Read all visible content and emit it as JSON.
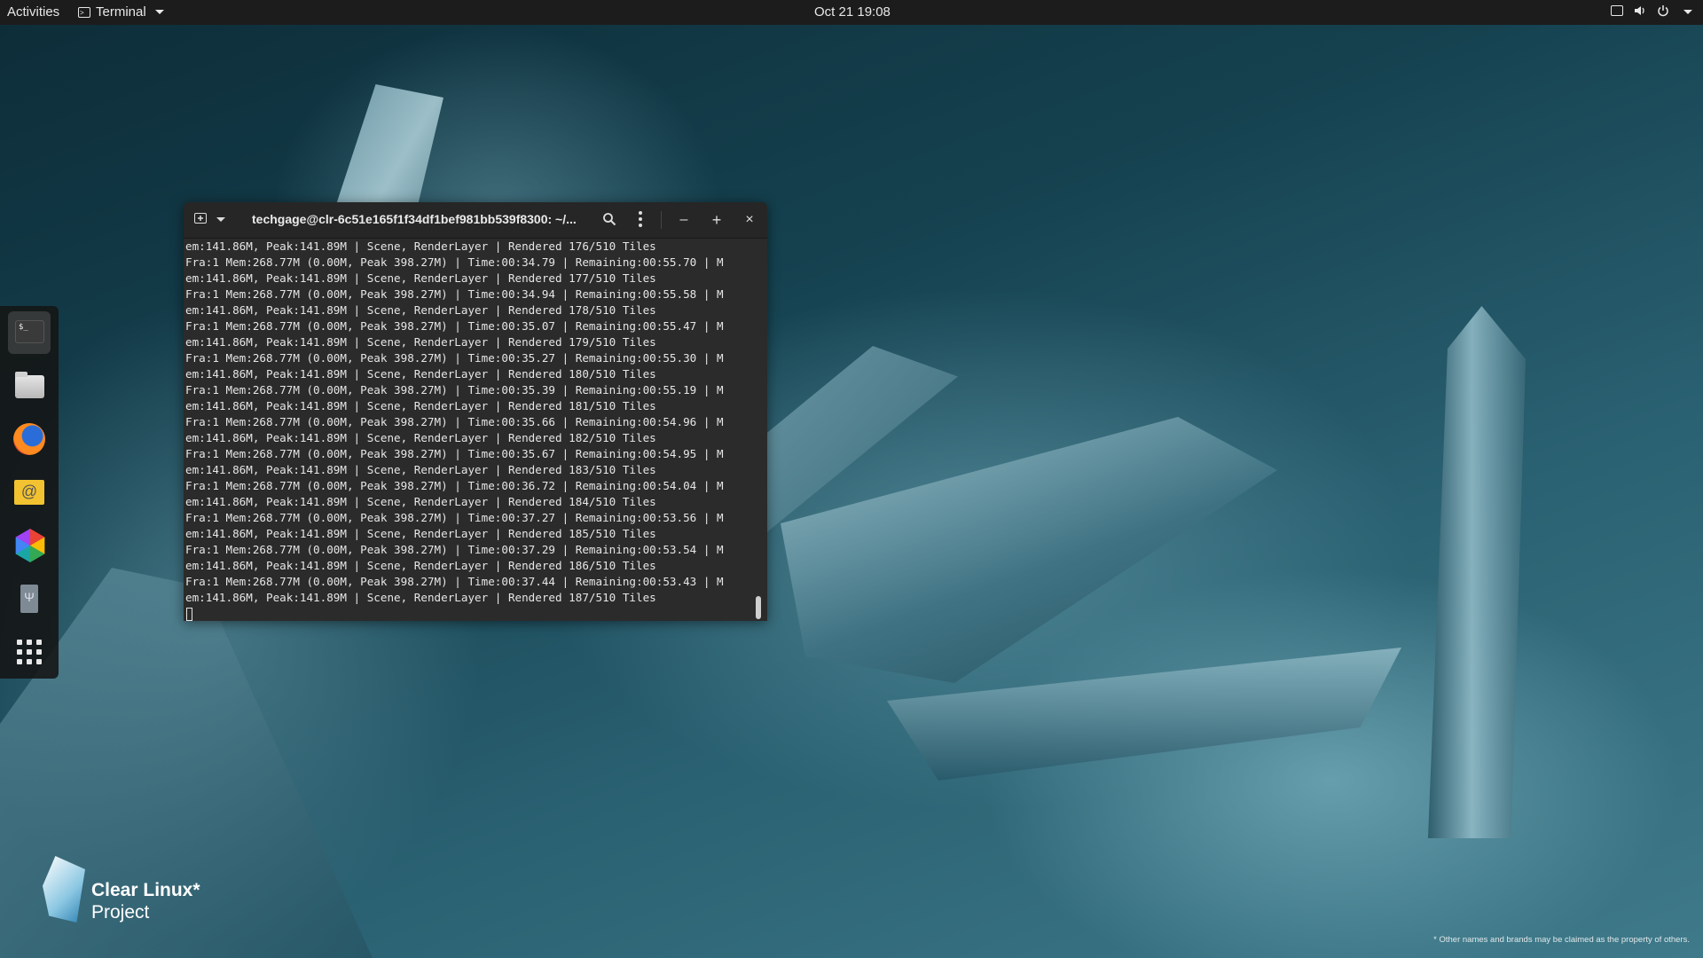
{
  "topbar": {
    "activities": "Activities",
    "app_name": "Terminal",
    "clock": "Oct 21  19:08",
    "tray_icons": [
      "screen-icon",
      "volume-icon",
      "power-icon",
      "chevron-down-icon"
    ]
  },
  "dock": {
    "items": [
      {
        "name": "terminal",
        "icon": "terminal-icon",
        "active": true
      },
      {
        "name": "files",
        "icon": "folder-icon",
        "active": false
      },
      {
        "name": "firefox",
        "icon": "firefox-icon",
        "active": false
      },
      {
        "name": "mail",
        "icon": "mail-icon",
        "active": false
      },
      {
        "name": "photos",
        "icon": "photos-icon",
        "active": false
      },
      {
        "name": "usb-drive",
        "icon": "usb-icon",
        "active": false
      },
      {
        "name": "show-applications",
        "icon": "grid-icon",
        "active": false
      }
    ]
  },
  "terminal": {
    "title": "techgage@clr-6c51e165f1f34df1bef981bb539f8300: ~/...",
    "lines": [
      "em:141.86M, Peak:141.89M | Scene, RenderLayer | Rendered 176/510 Tiles",
      "Fra:1 Mem:268.77M (0.00M, Peak 398.27M) | Time:00:34.79 | Remaining:00:55.70 | M",
      "em:141.86M, Peak:141.89M | Scene, RenderLayer | Rendered 177/510 Tiles",
      "Fra:1 Mem:268.77M (0.00M, Peak 398.27M) | Time:00:34.94 | Remaining:00:55.58 | M",
      "em:141.86M, Peak:141.89M | Scene, RenderLayer | Rendered 178/510 Tiles",
      "Fra:1 Mem:268.77M (0.00M, Peak 398.27M) | Time:00:35.07 | Remaining:00:55.47 | M",
      "em:141.86M, Peak:141.89M | Scene, RenderLayer | Rendered 179/510 Tiles",
      "Fra:1 Mem:268.77M (0.00M, Peak 398.27M) | Time:00:35.27 | Remaining:00:55.30 | M",
      "em:141.86M, Peak:141.89M | Scene, RenderLayer | Rendered 180/510 Tiles",
      "Fra:1 Mem:268.77M (0.00M, Peak 398.27M) | Time:00:35.39 | Remaining:00:55.19 | M",
      "em:141.86M, Peak:141.89M | Scene, RenderLayer | Rendered 181/510 Tiles",
      "Fra:1 Mem:268.77M (0.00M, Peak 398.27M) | Time:00:35.66 | Remaining:00:54.96 | M",
      "em:141.86M, Peak:141.89M | Scene, RenderLayer | Rendered 182/510 Tiles",
      "Fra:1 Mem:268.77M (0.00M, Peak 398.27M) | Time:00:35.67 | Remaining:00:54.95 | M",
      "em:141.86M, Peak:141.89M | Scene, RenderLayer | Rendered 183/510 Tiles",
      "Fra:1 Mem:268.77M (0.00M, Peak 398.27M) | Time:00:36.72 | Remaining:00:54.04 | M",
      "em:141.86M, Peak:141.89M | Scene, RenderLayer | Rendered 184/510 Tiles",
      "Fra:1 Mem:268.77M (0.00M, Peak 398.27M) | Time:00:37.27 | Remaining:00:53.56 | M",
      "em:141.86M, Peak:141.89M | Scene, RenderLayer | Rendered 185/510 Tiles",
      "Fra:1 Mem:268.77M (0.00M, Peak 398.27M) | Time:00:37.29 | Remaining:00:53.54 | M",
      "em:141.86M, Peak:141.89M | Scene, RenderLayer | Rendered 186/510 Tiles",
      "Fra:1 Mem:268.77M (0.00M, Peak 398.27M) | Time:00:37.44 | Remaining:00:53.43 | M",
      "em:141.86M, Peak:141.89M | Scene, RenderLayer | Rendered 187/510 Tiles"
    ],
    "header_icons": [
      "new-tab-icon",
      "dropdown-icon",
      "search-icon",
      "menu-icon",
      "minimize-icon",
      "maximize-icon",
      "close-icon"
    ]
  },
  "branding": {
    "name": "Clear Linux*",
    "sub": "Project",
    "disclaimer": "* Other names and brands may be claimed as the property of others."
  },
  "colors": {
    "topbar_bg": "#1c1c1c",
    "terminal_bg": "#2b2b2b",
    "terminal_header_bg": "#262626",
    "terminal_text": "#e6e6e6",
    "desktop_accent": "#15414f"
  }
}
